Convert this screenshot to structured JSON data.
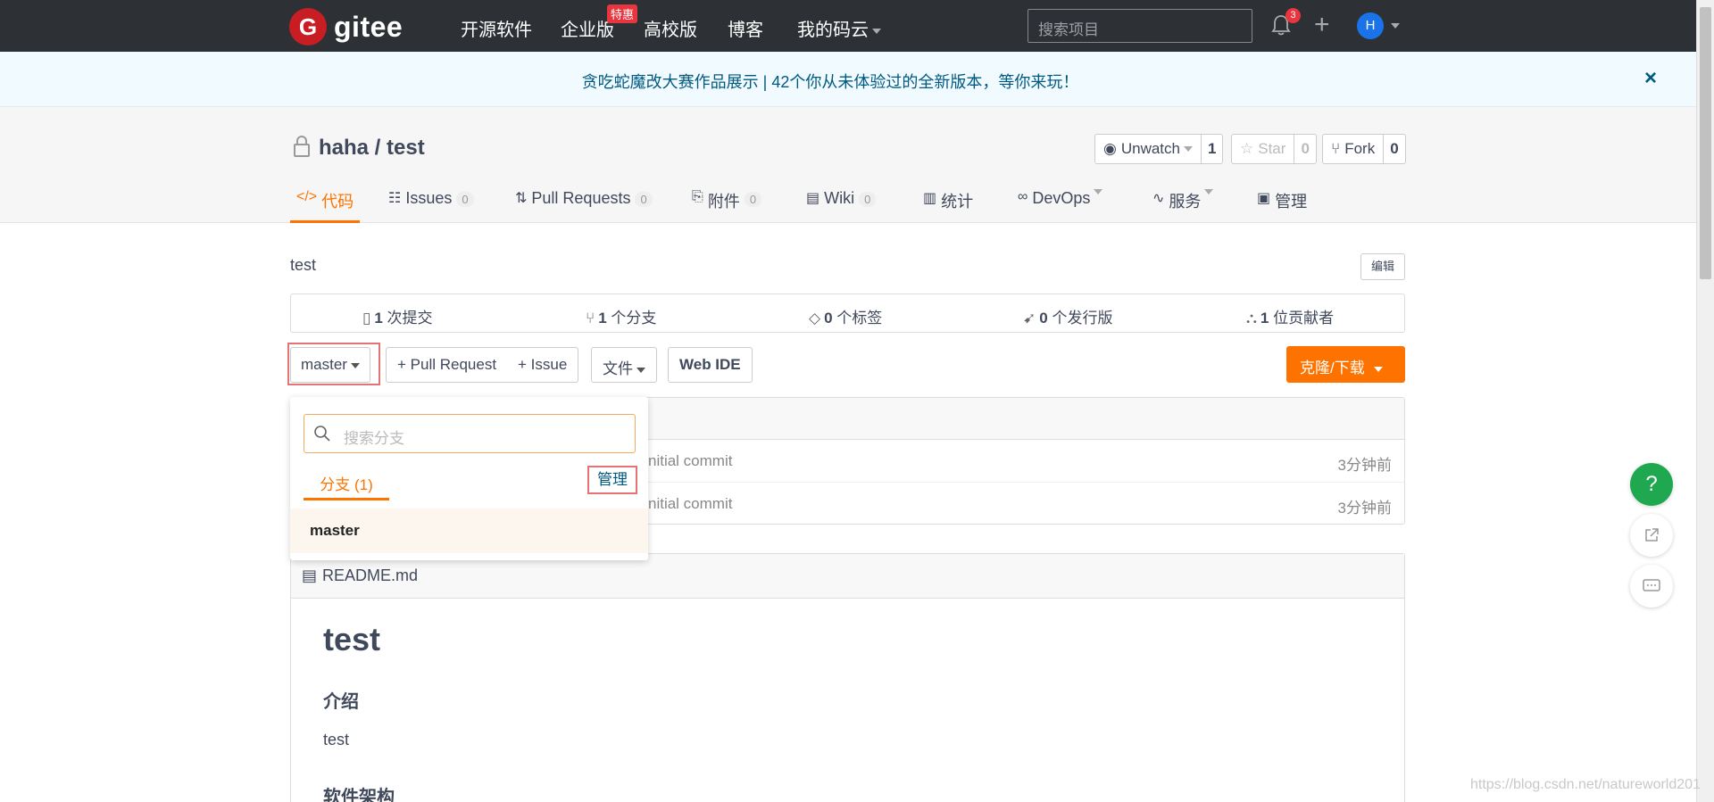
{
  "topnav": {
    "logo_glyph": "G",
    "logo_text": "gitee",
    "links": [
      "开源软件",
      "企业版",
      "高校版",
      "博客",
      "我的码云"
    ],
    "enterprise_badge": "特惠",
    "search_placeholder": "搜索项目",
    "notifications": "3",
    "plus": "+",
    "avatar": "H"
  },
  "banner": {
    "text": "贪吃蛇魔改大赛作品展示 | 42个你从未体验过的全新版本，等你来玩！",
    "close": "×"
  },
  "repo": {
    "title": "haha / test",
    "watch_label": "Unwatch",
    "watch_count": "1",
    "star_label": "Star",
    "star_count": "0",
    "fork_label": "Fork",
    "fork_count": "0"
  },
  "tabs": [
    {
      "icon": "</>",
      "label": "代码"
    },
    {
      "icon": "☷",
      "label": "Issues",
      "count": "0"
    },
    {
      "icon": "⇅",
      "label": "Pull Requests",
      "count": "0"
    },
    {
      "icon": "⎘",
      "label": "附件",
      "count": "0"
    },
    {
      "icon": "▤",
      "label": "Wiki",
      "count": "0"
    },
    {
      "icon": "▥",
      "label": "统计"
    },
    {
      "icon": "∞",
      "label": "DevOps"
    },
    {
      "icon": "∿",
      "label": "服务"
    },
    {
      "icon": "▣",
      "label": "管理"
    }
  ],
  "description": "test",
  "edit_label": "编辑",
  "stats": [
    {
      "num": "1",
      "label": " 次提交"
    },
    {
      "num": "1",
      "label": " 个分支"
    },
    {
      "num": "0",
      "label": " 个标签"
    },
    {
      "num": "0",
      "label": " 个发行版"
    },
    {
      "num": "1",
      "label": " 位贡献者"
    }
  ],
  "actions": {
    "branch": "master",
    "pull_request": "+ Pull Request",
    "issue": "+ Issue",
    "file": "文件",
    "web_ide": "Web IDE",
    "clone": "克隆/下载"
  },
  "commits": [
    {
      "msg": "nitial commit",
      "time": "3分钟前"
    },
    {
      "msg": "nitial commit",
      "time": "3分钟前"
    }
  ],
  "dropdown": {
    "search_placeholder": "搜索分支",
    "tab_label": "分支 (1)",
    "manage": "管理",
    "branches": [
      "master"
    ]
  },
  "readme": {
    "filename": "README.md",
    "h1": "test",
    "h_intro": "介绍",
    "intro_text": "test",
    "h_arch": "软件架构"
  },
  "fabs": {
    "help": "?"
  },
  "watermark": "https://blog.csdn.net/natureworld201"
}
